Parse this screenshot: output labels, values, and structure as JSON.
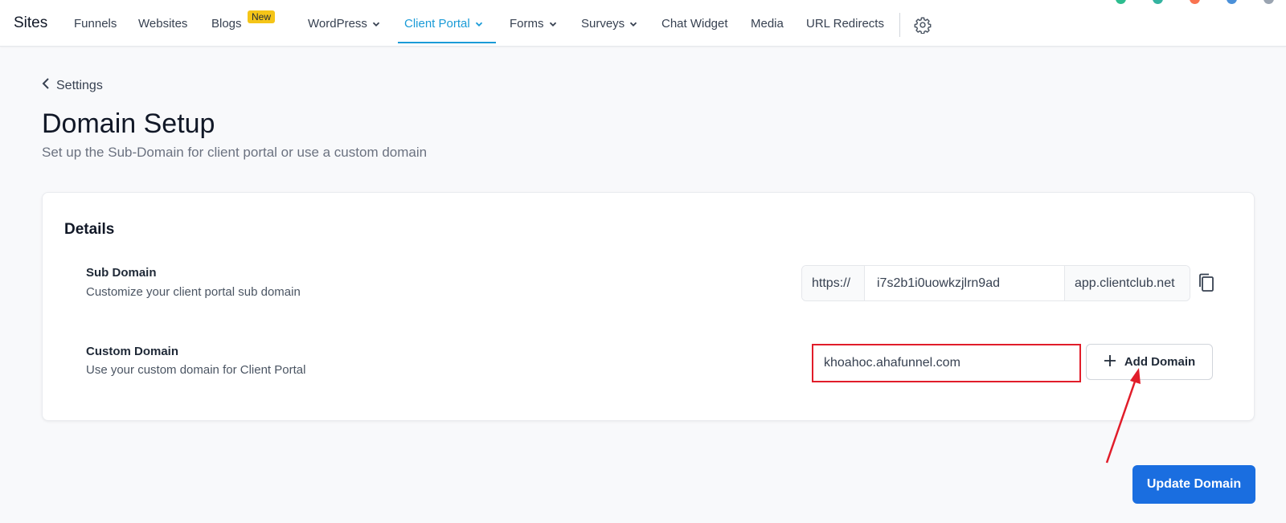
{
  "nav": {
    "brand": "Sites",
    "items": [
      {
        "label": "Funnels"
      },
      {
        "label": "Websites"
      },
      {
        "label": "Blogs",
        "badge": "New"
      },
      {
        "label": "WordPress"
      },
      {
        "label": "Client Portal"
      },
      {
        "label": "Forms"
      },
      {
        "label": "Surveys"
      },
      {
        "label": "Chat Widget"
      },
      {
        "label": "Media"
      },
      {
        "label": "URL Redirects"
      }
    ],
    "settings_icon": "gear-icon"
  },
  "page": {
    "back_label": "Settings",
    "title": "Domain Setup",
    "subtitle": "Set up the Sub-Domain for client portal or use a custom domain"
  },
  "card": {
    "title": "Details",
    "sub_domain": {
      "label": "Sub Domain",
      "description": "Customize your client portal sub domain",
      "prefix": "https://",
      "value": "i7s2b1i0uowkzjlrn9ad",
      "suffix": "app.clientclub.net",
      "copy_icon": "copy-icon"
    },
    "custom_domain": {
      "label": "Custom Domain",
      "description": "Use your custom domain for Client Portal",
      "value": "khoahoc.ahafunnel.com",
      "add_button": "Add Domain"
    }
  },
  "update_button": "Update Domain",
  "colors": {
    "accent": "#1a9bd7",
    "primary_button": "#1a6ee0",
    "highlight_box": "#e11d2a",
    "new_badge": "#f5c518"
  }
}
